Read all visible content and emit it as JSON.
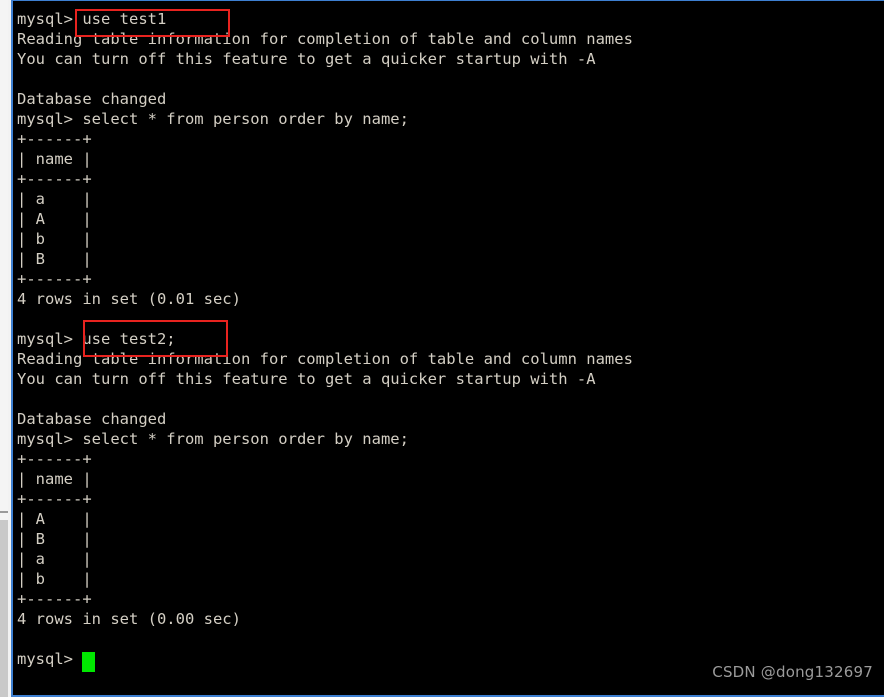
{
  "window": {
    "type": "terminal",
    "background_color": "#000000",
    "text_color": "#d4cfc4",
    "border_color": "#3d7fd1"
  },
  "terminal": {
    "prompt": "mysql>",
    "lines": [
      {
        "text": "mysql> use test1"
      },
      {
        "text": "Reading table information for completion of table and column names"
      },
      {
        "text": "You can turn off this feature to get a quicker startup with -A"
      },
      {
        "text": ""
      },
      {
        "text": "Database changed"
      },
      {
        "text": "mysql> select * from person order by name;"
      },
      {
        "text": "+------+"
      },
      {
        "text": "| name |"
      },
      {
        "text": "+------+"
      },
      {
        "text": "| a    |"
      },
      {
        "text": "| A    |"
      },
      {
        "text": "| b    |"
      },
      {
        "text": "| B    |"
      },
      {
        "text": "+------+"
      },
      {
        "text": "4 rows in set (0.01 sec)"
      },
      {
        "text": ""
      },
      {
        "text": "mysql> use test2;"
      },
      {
        "text": "Reading table information for completion of table and column names"
      },
      {
        "text": "You can turn off this feature to get a quicker startup with -A"
      },
      {
        "text": ""
      },
      {
        "text": "Database changed"
      },
      {
        "text": "mysql> select * from person order by name;"
      },
      {
        "text": "+------+"
      },
      {
        "text": "| name |"
      },
      {
        "text": "+------+"
      },
      {
        "text": "| A    |"
      },
      {
        "text": "| B    |"
      },
      {
        "text": "| a    |"
      },
      {
        "text": "| b    |"
      },
      {
        "text": "+------+"
      },
      {
        "text": "4 rows in set (0.00 sec)"
      },
      {
        "text": ""
      },
      {
        "text": "mysql> "
      }
    ]
  },
  "annotations": {
    "color": "#e8231f",
    "boxes": [
      {
        "label": "use test1",
        "target_line": 0
      },
      {
        "label": "use test2;",
        "target_line": 16
      }
    ]
  },
  "cursor": {
    "color": "#00e800",
    "visible": true
  },
  "watermark": {
    "text": "CSDN @dong132697"
  },
  "scrollbar": {
    "orientation": "vertical",
    "position": "left",
    "track_color": "#f4f4f4",
    "thumb_color": "#c9c9c9"
  }
}
